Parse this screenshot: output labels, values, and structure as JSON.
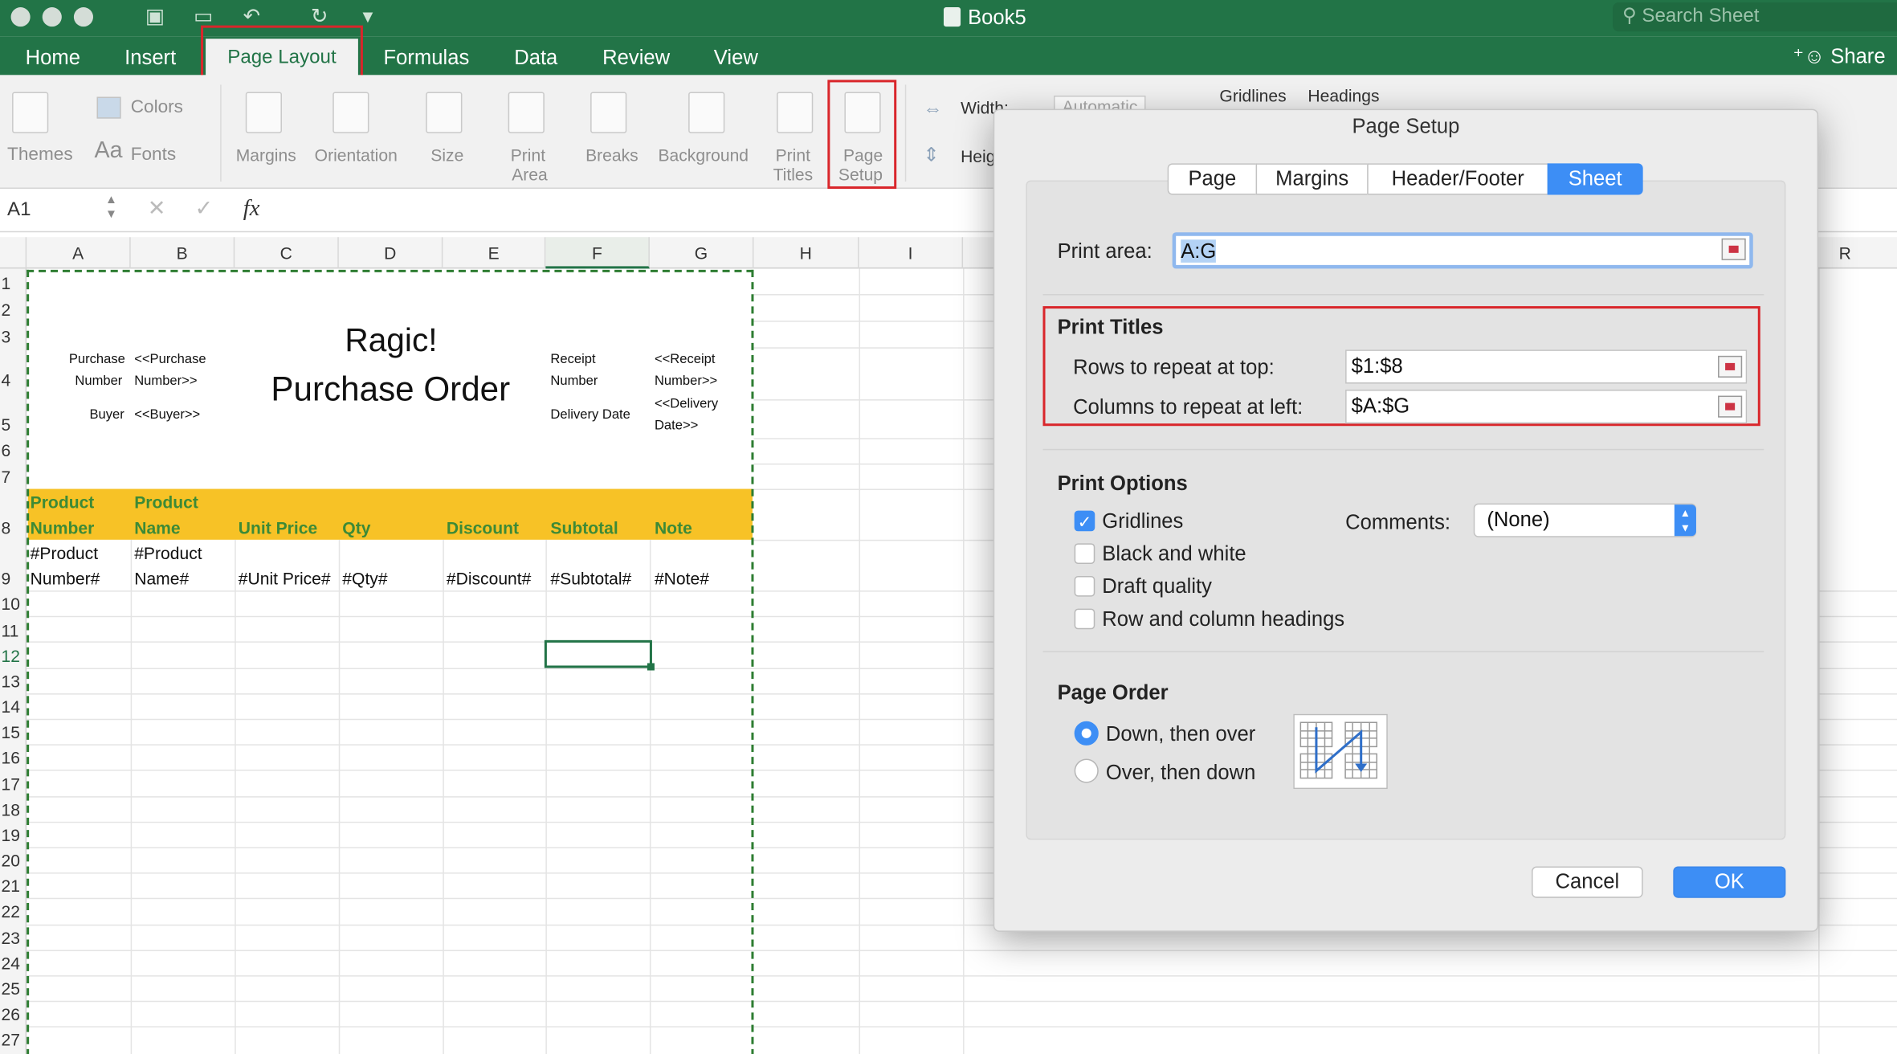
{
  "window": {
    "title": "Book5",
    "search_placeholder": "Search Sheet",
    "share": "Share"
  },
  "tabs": [
    "Home",
    "Insert",
    "Page Layout",
    "Formulas",
    "Data",
    "Review",
    "View"
  ],
  "ribbon": {
    "themes": "Themes",
    "colors": "Colors",
    "fonts": "Fonts",
    "fonts_glyph": "Aa",
    "margins": "Margins",
    "orientation": "Orientation",
    "size": "Size",
    "print_area_1": "Print",
    "print_area_2": "Area",
    "breaks": "Breaks",
    "background": "Background",
    "print_titles_1": "Print",
    "print_titles_2": "Titles",
    "page_setup_1": "Page",
    "page_setup_2": "Setup",
    "width": "Width:",
    "width_value": "Automatic",
    "height": "Heig",
    "gridlines": "Gridlines",
    "headings": "Headings"
  },
  "formula_bar": {
    "name_box": "A1",
    "fx": "fx"
  },
  "columns": [
    "A",
    "B",
    "C",
    "D",
    "E",
    "F",
    "G",
    "H",
    "I",
    "R"
  ],
  "rows": [
    "1",
    "2",
    "3",
    "4",
    "5",
    "6",
    "7",
    "8",
    "9",
    "10",
    "11",
    "12",
    "13",
    "14",
    "15",
    "16",
    "17",
    "18",
    "19",
    "20",
    "21",
    "22",
    "23",
    "24",
    "25",
    "26",
    "27"
  ],
  "sheet": {
    "title1": "Ragic!",
    "title2": "Purchase Order",
    "purchase": "Purchase",
    "number": "Number",
    "buyer": "Buyer",
    "purchase_ph1": "<<Purchase",
    "purchase_ph2": "Number>>",
    "buyer_ph": "<<Buyer>>",
    "receipt": "Receipt",
    "receipt_number": "Number",
    "delivery_date": "Delivery Date",
    "receipt_ph1": "<<Receipt",
    "receipt_ph2": "Number>>",
    "delivery_ph1": "<<Delivery",
    "delivery_ph2": "Date>>",
    "h_prod_num1": "Product",
    "h_prod_num2": "Number",
    "h_prod_name1": "Product",
    "h_prod_name2": "Name",
    "h_unit_price": "Unit Price",
    "h_qty": "Qty",
    "h_discount": "Discount",
    "h_subtotal": "Subtotal",
    "h_note": "Note",
    "r_prod_num1": "#Product",
    "r_prod_num2": "Number#",
    "r_prod_name1": "#Product",
    "r_prod_name2": "Name#",
    "r_unit_price": "#Unit Price#",
    "r_qty": "#Qty#",
    "r_discount": "#Discount#",
    "r_subtotal": "#Subtotal#",
    "r_note": "#Note#"
  },
  "dialog": {
    "title": "Page Setup",
    "tabs": [
      "Page",
      "Margins",
      "Header/Footer",
      "Sheet"
    ],
    "print_area_label": "Print area:",
    "print_area_value": "A:G",
    "print_titles": "Print Titles",
    "rows_repeat_label": "Rows to repeat at top:",
    "rows_repeat_value": "$1:$8",
    "cols_repeat_label": "Columns to repeat at left:",
    "cols_repeat_value": "$A:$G",
    "print_options": "Print Options",
    "gridlines": "Gridlines",
    "black_white": "Black and white",
    "draft": "Draft quality",
    "headings": "Row and column headings",
    "comments_label": "Comments:",
    "comments_value": "(None)",
    "page_order": "Page Order",
    "down_over": "Down, then over",
    "over_down": "Over, then down",
    "cancel": "Cancel",
    "ok": "OK"
  },
  "colors": {
    "excel_green": "#227447",
    "highlight": "#d9262b",
    "header_band": "#f7c226",
    "mac_blue": "#3d8ef5"
  }
}
